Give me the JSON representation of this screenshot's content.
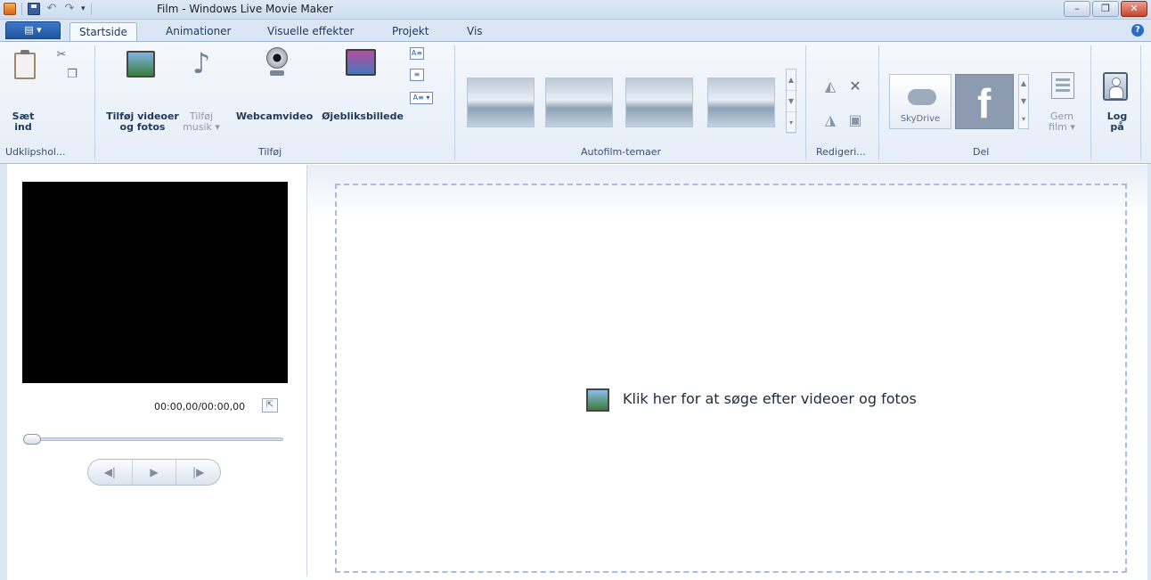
{
  "window": {
    "title": "Film - Windows Live Movie Maker",
    "minimize_label": "–",
    "restore_label": "❐",
    "close_label": "✕"
  },
  "qat": {
    "undo_icon": "↶",
    "redo_icon": "↷",
    "dropdown_icon": "▾"
  },
  "tabs": {
    "app_menu": "▤ ▾",
    "items": [
      "Startside",
      "Animationer",
      "Visuelle effekter",
      "Projekt",
      "Vis"
    ],
    "help": "?"
  },
  "ribbon": {
    "clipboard": {
      "paste_label_1": "Sæt",
      "paste_label_2": "ind",
      "cut_icon": "✂",
      "copy_icon": "❐",
      "group_label": "Udklipshol..."
    },
    "add": {
      "add_videos_label_1": "Tilføj videoer",
      "add_videos_label_2": "og fotos",
      "add_music_label_1": "Tilføj",
      "add_music_label_2": "musik ▾",
      "note_icon": "♪",
      "webcam_label": "Webcamvideo",
      "snapshot_label": "Øjebliksbillede",
      "mini1": "A≡",
      "mini2": "≡",
      "mini3": "A≡ ▾",
      "group_label": "Tilføj"
    },
    "themes": {
      "group_label": "Autofilm-temaer",
      "scroll_up": "▲",
      "scroll_down": "▼",
      "scroll_more": "▾"
    },
    "edit": {
      "rotate_left_icon": "◭",
      "remove_icon": "✕",
      "rotate_right_icon": "◮",
      "select_all_icon": "▣",
      "group_label": "Redigeri..."
    },
    "share": {
      "skydrive_label": "SkyDrive",
      "facebook_glyph": "f",
      "group_label": "Del",
      "save_movie_label_1": "Gem",
      "save_movie_label_2": "film ▾",
      "sign_in_label_1": "Log",
      "sign_in_label_2": "på"
    }
  },
  "preview": {
    "timecode": "00:00,00/00:00,00",
    "expand_icon": "⇱",
    "prev_frame": "◀|",
    "play": "▶",
    "next_frame": "|▶"
  },
  "storyboard": {
    "prompt": "Klik her for at søge efter videoer og fotos"
  },
  "colors": {
    "accent": "#1f56a3",
    "drop_border": "#a6bde0"
  }
}
